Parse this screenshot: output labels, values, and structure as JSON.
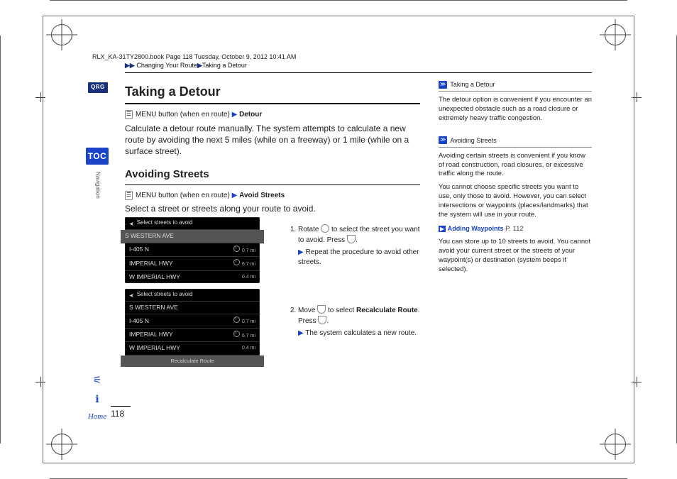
{
  "header_stamp": "RLX_KA-31TY2800.book  Page 118  Tuesday, October 9, 2012  10:41 AM",
  "breadcrumb": {
    "arrow": "▶▶",
    "seg1": "Changing Your Route",
    "seg2": "Taking a Detour"
  },
  "qrg": "QRG",
  "toc": "TOC",
  "nav_label": "Navigation",
  "home_label": "Home",
  "page_number": "118",
  "h1": "Taking a Detour",
  "detour_crumb_prefix": "MENU button (when en route)",
  "detour_crumb_bold": "Detour",
  "detour_body": "Calculate a detour route manually. The system attempts to calculate a new route by avoiding the next 5 miles (while on a freeway) or 1 mile (while on a surface street).",
  "h2": "Avoiding Streets",
  "avoid_crumb_prefix": "MENU button (when en route)",
  "avoid_crumb_bold": "Avoid Streets",
  "avoid_intro": "Select a street or streets along your route to avoid.",
  "screen1": {
    "title": "Select streets to avoid",
    "rows": [
      {
        "name": "S WESTERN AVE",
        "dist": ""
      },
      {
        "name": "I-405 N",
        "dist": "0.7 mi",
        "info": true
      },
      {
        "name": "IMPERIAL HWY",
        "dist": "6.7 mi",
        "info": true
      },
      {
        "name": "W IMPERIAL HWY",
        "dist": "0.4 mi"
      }
    ]
  },
  "screen2": {
    "title": "Select streets to avoid",
    "rows": [
      {
        "name": "S WESTERN AVE",
        "dist": ""
      },
      {
        "name": "I-405 N",
        "dist": "0.7 mi",
        "info": true
      },
      {
        "name": "IMPERIAL HWY",
        "dist": "6.7 mi",
        "info": true
      },
      {
        "name": "W IMPERIAL HWY",
        "dist": "0.4 mi"
      }
    ],
    "footer": "Recalculate Route"
  },
  "step1_a": "Rotate",
  "step1_b": "to select the street you want to avoid. Press",
  "step1_sub": "Repeat the procedure to avoid other streets.",
  "step2_a": "Move",
  "step2_b": "to select",
  "step2_bold": "Recalculate Route",
  "step2_c": ". Press",
  "step2_sub": "The system calculates a new route.",
  "side_detour_title": "Taking a Detour",
  "side_detour_body": "The detour option is convenient if you encounter an unexpected obstacle such as a road closure or extremely heavy traffic congestion.",
  "side_avoid_title": "Avoiding Streets",
  "side_avoid_p1": "Avoiding certain streets is convenient if you know of road construction, road closures, or excessive traffic along the route.",
  "side_avoid_p2": "You cannot choose specific streets you want to use, only those to avoid. However, you can select intersections or waypoints (places/landmarks) that the system will use in your route.",
  "side_link": "Adding Waypoints",
  "side_link_page": "P. 112",
  "side_avoid_p3": "You can store up to 10 streets to avoid. You cannot avoid your current street or the streets of your waypoint(s) or destination (system beeps if selected)."
}
